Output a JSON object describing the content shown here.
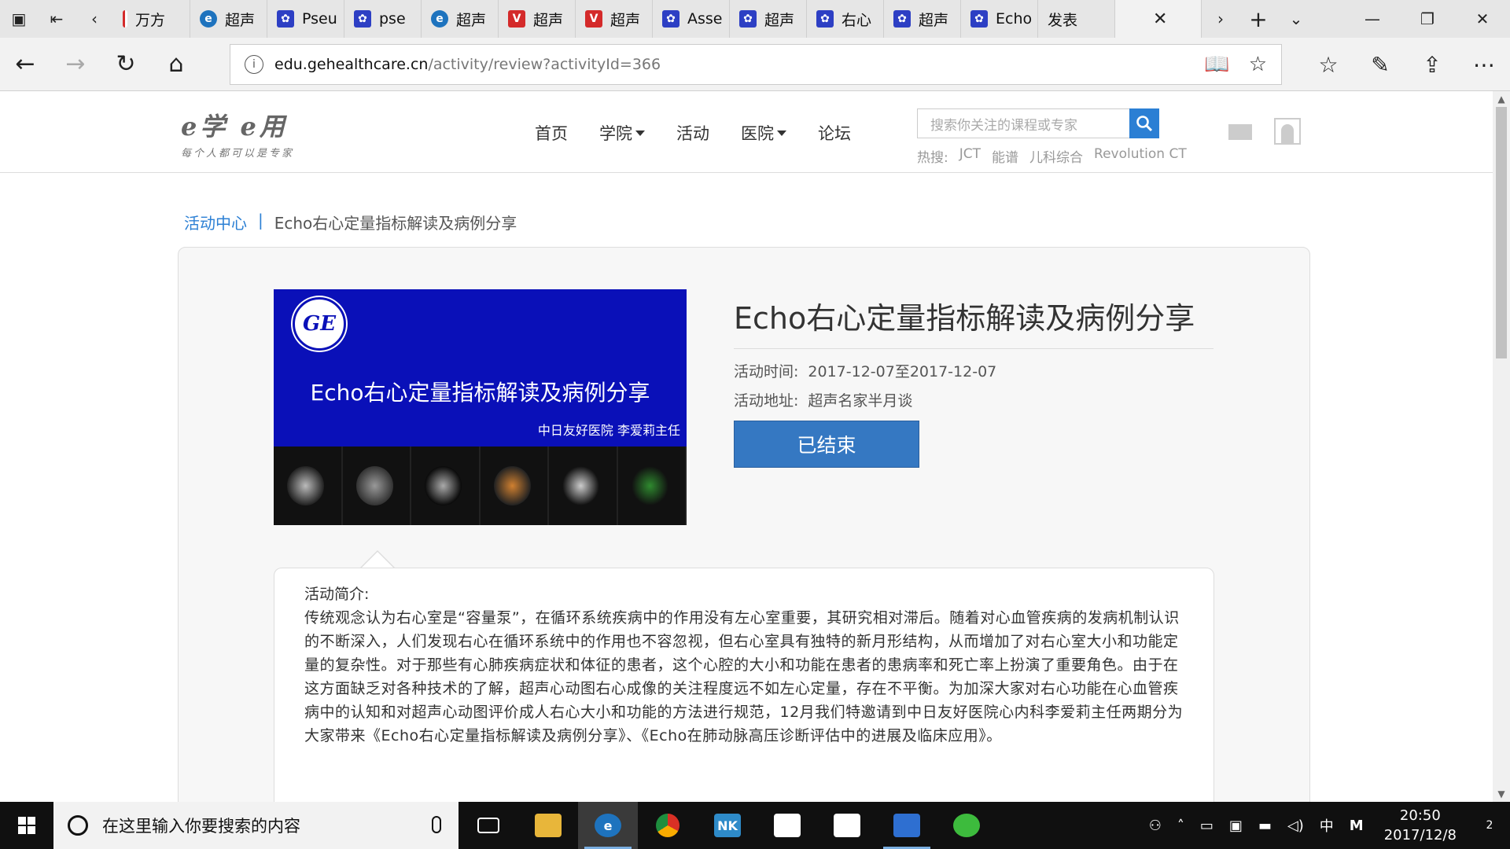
{
  "browser": {
    "tabs": [
      {
        "label": "万方",
        "icon": "red-bar-icon"
      },
      {
        "label": "超声",
        "icon": "ie-icon"
      },
      {
        "label": "Pseu",
        "icon": "baidu-paw-icon"
      },
      {
        "label": "pse",
        "icon": "baidu-paw-icon"
      },
      {
        "label": "超声",
        "icon": "ie-icon"
      },
      {
        "label": "超声",
        "icon": "v-icon"
      },
      {
        "label": "超声",
        "icon": "v-icon"
      },
      {
        "label": "Asse",
        "icon": "baidu-paw-icon"
      },
      {
        "label": "超声",
        "icon": "baidu-paw-icon"
      },
      {
        "label": "右心",
        "icon": "baidu-paw-icon"
      },
      {
        "label": "超声",
        "icon": "baidu-paw-icon"
      },
      {
        "label": "Echo",
        "icon": "baidu-paw-icon"
      },
      {
        "label": "发表",
        "icon": "page-icon"
      }
    ],
    "url_host": "edu.gehealthcare.cn",
    "url_path": "/activity/review?activityId=366"
  },
  "site": {
    "logo_line1": "e学 e用",
    "logo_line2": "每个人都可以是专家",
    "nav": [
      {
        "label": "首页",
        "dropdown": false
      },
      {
        "label": "学院",
        "dropdown": true
      },
      {
        "label": "活动",
        "dropdown": false
      },
      {
        "label": "医院",
        "dropdown": true
      },
      {
        "label": "论坛",
        "dropdown": false
      }
    ],
    "search_placeholder": "搜索你关注的课程或专家",
    "hot_label": "热搜:",
    "hot_terms": [
      "JCT",
      "能谱",
      "儿科综合",
      "Revolution CT"
    ]
  },
  "breadcrumb": {
    "root": "活动中心",
    "sep": "|",
    "current": "Echo右心定量指标解读及病例分享"
  },
  "activity": {
    "banner_logo": "GE",
    "banner_title": "Echo右心定量指标解读及病例分享",
    "banner_subtitle": "中日友好医院  李爱莉主任",
    "title": "Echo右心定量指标解读及病例分享",
    "time_label": "活动时间:",
    "time_value": "2017-12-07至2017-12-07",
    "place_label": "活动地址:",
    "place_value": "超声名家半月谈",
    "status": "已结束",
    "desc_heading": "活动简介:",
    "desc_body": "传统观念认为右心室是“容量泵”，在循环系统疾病中的作用没有左心室重要，其研究相对滞后。随着对心血管疾病的发病机制认识的不断深入，人们发现右心在循环系统中的作用也不容忽视，但右心室具有独特的新月形结构，从而增加了对右心室大小和功能定量的复杂性。对于那些有心肺疾病症状和体征的患者，这个心腔的大小和功能在患者的患病率和死亡率上扮演了重要角色。由于在这方面缺乏对各种技术的了解，超声心动图右心成像的关注程度远不如左心定量，存在不平衡。为加深大家对右心功能在心血管疾病中的认知和对超声心动图评价成人右心大小和功能的方法进行规范，12月我们特邀请到中日友好医院心内科李爱莉主任两期分为大家带来《Echo右心定量指标解读及病例分享》、《Echo在肺动脉高压诊断评估中的进展及临床应用》。"
  },
  "taskbar": {
    "search_placeholder": "在这里输入你要搜索的内容",
    "time": "20:50",
    "date": "2017/12/8",
    "ime": "中",
    "notifications": "2"
  },
  "colors": {
    "brand_blue": "#2b7fd4",
    "status_button": "#3578c2",
    "banner_bg": "#0a10b8"
  }
}
